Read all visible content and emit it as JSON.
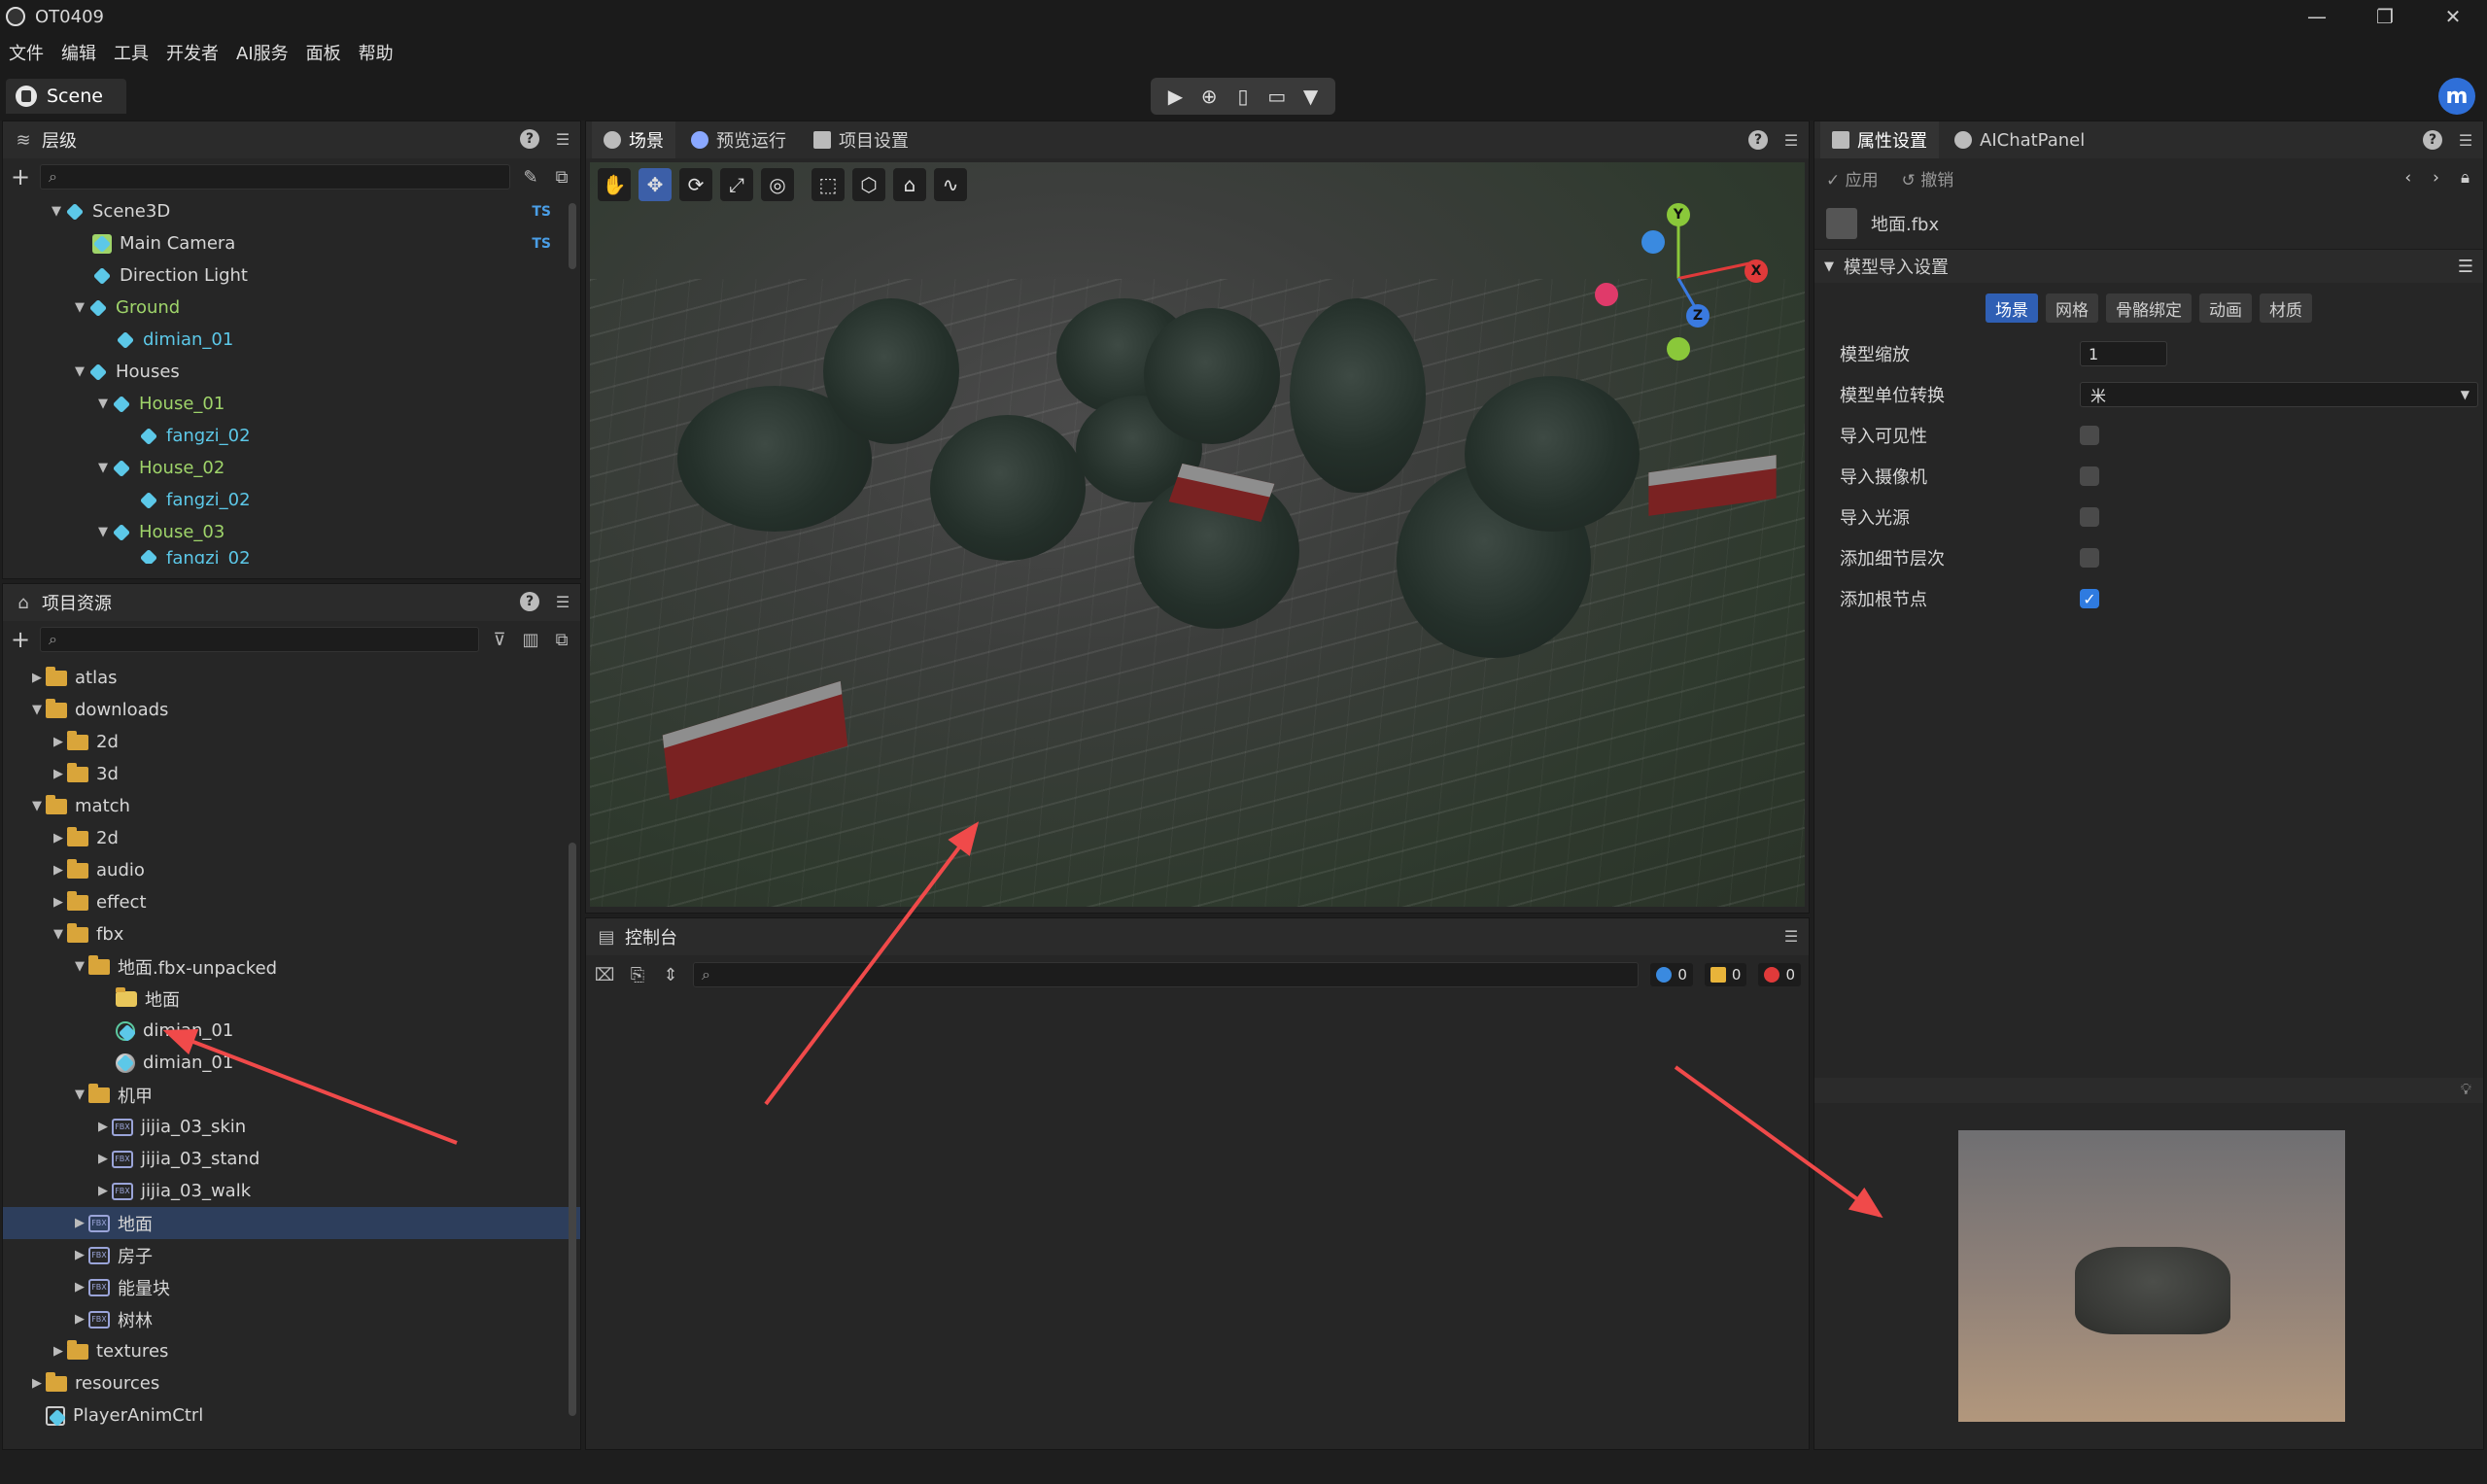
{
  "window": {
    "title": "OT0409"
  },
  "menu": [
    "文件",
    "编辑",
    "工具",
    "开发者",
    "AI服务",
    "面板",
    "帮助"
  ],
  "scene_tab": "Scene",
  "avatar_letter": "m",
  "hierarchy": {
    "title": "层级",
    "items": [
      {
        "label": "Scene3D",
        "ts": "TS"
      },
      {
        "label": "Main Camera",
        "ts": "TS"
      },
      {
        "label": "Direction Light"
      },
      {
        "label": "Ground"
      },
      {
        "label": "dimian_01"
      },
      {
        "label": "Houses"
      },
      {
        "label": "House_01"
      },
      {
        "label": "fangzi_02"
      },
      {
        "label": "House_02"
      },
      {
        "label": "fangzi_02"
      },
      {
        "label": "House_03"
      },
      {
        "label": "fangzi_02"
      }
    ]
  },
  "assets": {
    "title": "项目资源",
    "items": [
      {
        "label": "atlas"
      },
      {
        "label": "downloads"
      },
      {
        "label": "2d"
      },
      {
        "label": "3d"
      },
      {
        "label": "match"
      },
      {
        "label": "2d"
      },
      {
        "label": "audio"
      },
      {
        "label": "effect"
      },
      {
        "label": "fbx"
      },
      {
        "label": "地面.fbx-unpacked"
      },
      {
        "label": "地面"
      },
      {
        "label": "dimian_01"
      },
      {
        "label": "dimian_01"
      },
      {
        "label": "机甲"
      },
      {
        "label": "jijia_03_skin"
      },
      {
        "label": "jijia_03_stand"
      },
      {
        "label": "jijia_03_walk"
      },
      {
        "label": "地面"
      },
      {
        "label": "房子"
      },
      {
        "label": "能量块"
      },
      {
        "label": "树林"
      },
      {
        "label": "textures"
      },
      {
        "label": "resources"
      },
      {
        "label": "PlayerAnimCtrl"
      }
    ]
  },
  "scene_tabs": [
    "场景",
    "预览运行",
    "项目设置"
  ],
  "gizmo": {
    "y": "Y",
    "x": "X",
    "z": "Z"
  },
  "console": {
    "title": "控制台",
    "counts": {
      "info": "0",
      "warn": "0",
      "error": "0"
    }
  },
  "inspector": {
    "tabs": [
      "属性设置",
      "AIChatPanel"
    ],
    "apply": "应用",
    "revert": "撤销",
    "asset_name": "地面.fbx",
    "section": "模型导入设置",
    "subtabs": [
      "场景",
      "网格",
      "骨骼绑定",
      "动画",
      "材质"
    ],
    "props": {
      "scale_label": "模型缩放",
      "scale_value": "1",
      "unit_label": "模型单位转换",
      "unit_value": "米",
      "visible_label": "导入可见性",
      "camera_label": "导入摄像机",
      "light_label": "导入光源",
      "lod_label": "添加细节层次",
      "root_label": "添加根节点"
    }
  },
  "colors": {
    "accent": "#2f5fb4",
    "arrow": "#f04a4a"
  }
}
